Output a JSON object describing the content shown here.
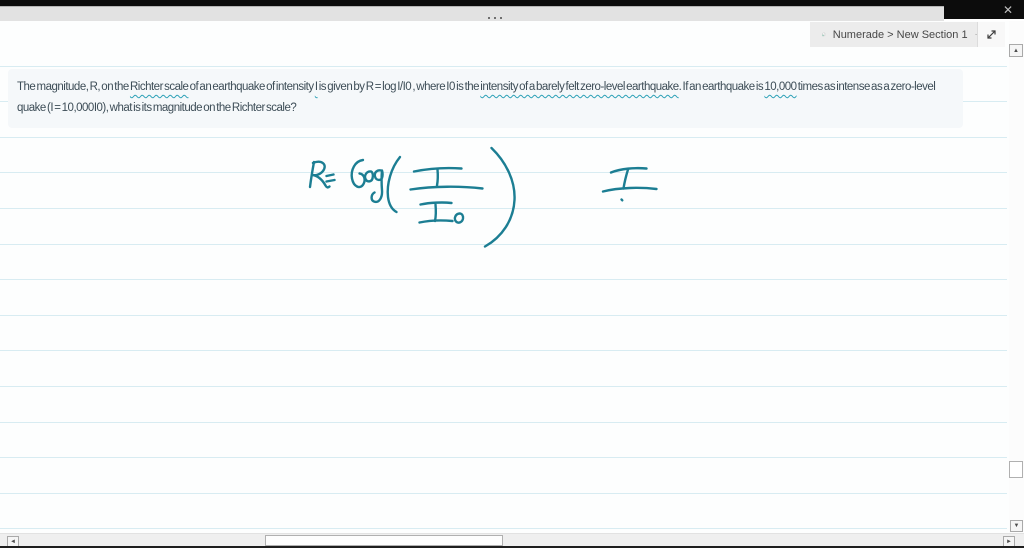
{
  "window": {
    "close_icon_glyph": "✕"
  },
  "toolbar": {
    "breadcrumb_label": "Numerade > New Section 1"
  },
  "question": {
    "segments": [
      {
        "text": "The magnitude, R, on the ",
        "underlined": false
      },
      {
        "text": "Richter scale",
        "underlined": true
      },
      {
        "text": " of an earthquake of intensity ",
        "underlined": false
      },
      {
        "text": "I",
        "underlined": true
      },
      {
        "text": " is given by R = log I/I0 , where I0 is the ",
        "underlined": false
      },
      {
        "text": "intensity of a barely felt zero-level earthquake",
        "underlined": true
      },
      {
        "text": ". If an earthquake is ",
        "underlined": false
      },
      {
        "text": "10,000",
        "underlined": true
      },
      {
        "text": " times as intense as a zero-level quake (I = 10,000I0), what is its magnitude on the Richter scale?",
        "underlined": false
      }
    ]
  },
  "whiteboard": {
    "ink_transcript": "R = log ( I / I0 )   I",
    "ink_color": "#1c7e93",
    "rule_line_color": "#d8ecf2",
    "rule_first_y": 44.6,
    "rule_spacing": 35.6,
    "rule_count": 14,
    "rule_width": 1007
  },
  "scrollbars": {
    "up_glyph": "▲",
    "down_glyph": "▼",
    "left_glyph": "◄",
    "right_glyph": "►"
  }
}
